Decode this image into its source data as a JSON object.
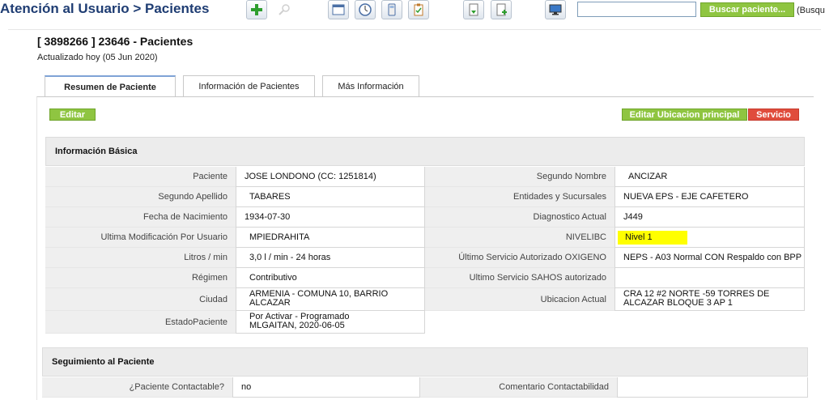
{
  "header": {
    "breadcrumb": "Atención al Usuario > Pacientes",
    "toolbar_icons": [
      "add-icon",
      "search-magnifier-icon",
      "window-icon",
      "clock-icon",
      "calculator-icon",
      "clipboard-icon",
      "document-download-icon",
      "document-add-icon",
      "monitor-icon"
    ],
    "search": {
      "value": "",
      "button_label": "Buscar paciente...",
      "hint": "(Busqu"
    }
  },
  "patient": {
    "title": "[ 3898266 ] 23646 - Pacientes",
    "updated": "Actualizado hoy (05 Jun 2020)"
  },
  "tabs": [
    {
      "label": "Resumen de Paciente",
      "active": true
    },
    {
      "label": "Información de Pacientes",
      "active": false
    },
    {
      "label": "Más Información",
      "active": false
    }
  ],
  "actions": {
    "edit": "Editar",
    "edit_location": "Editar Ubicacion principal",
    "service": "Servicio"
  },
  "basic_info": {
    "title": "Información Básica",
    "left": [
      {
        "label": "Paciente",
        "value": "JOSE LONDONO (CC: 1251814)"
      },
      {
        "label": "Segundo Apellido",
        "value": "TABARES"
      },
      {
        "label": "Fecha de Nacimiento",
        "value": "1934-07-30"
      },
      {
        "label": "Ultima Modificación Por Usuario",
        "value": "MPIEDRAHITA"
      },
      {
        "label": "Litros / min",
        "value": "3,0 l / min - 24 horas"
      },
      {
        "label": "Régimen",
        "value": "Contributivo"
      },
      {
        "label": "Ciudad",
        "value": "ARMENIA - COMUNA 10, BARRIO ALCAZAR"
      },
      {
        "label": "EstadoPaciente",
        "value": "Por Activar - Programado MLGAITAN, 2020-06-05"
      }
    ],
    "right": [
      {
        "label": "Segundo Nombre",
        "value": "ANCIZAR"
      },
      {
        "label": "Entidades y Sucursales",
        "value": "NUEVA EPS - EJE CAFETERO"
      },
      {
        "label": "Diagnostico Actual",
        "value": "J449"
      },
      {
        "label": "NIVELIBC",
        "value": "Nivel 1"
      },
      {
        "label": "Último Servicio Autorizado OXIGENO",
        "value": "NEPS - A03 Normal CON Respaldo con BPP"
      },
      {
        "label": "Ultimo Servicio SAHOS autorizado",
        "value": ""
      },
      {
        "label": "Ubicacion Actual",
        "value": "CRA 12 #2 NORTE -59 TORRES DE ALCAZAR BLOQUE 3 AP 1"
      }
    ]
  },
  "follow_up": {
    "title": "Seguimiento al Paciente",
    "rows": [
      {
        "label": "¿Paciente Contactable?",
        "value": "no",
        "label2": "Comentario Contactabilidad",
        "value2": ""
      }
    ]
  },
  "colors": {
    "title_blue": "#1f3d73",
    "green_button": "#8fc541",
    "red_button": "#e04c3c",
    "highlight_yellow": "#ffff00"
  }
}
